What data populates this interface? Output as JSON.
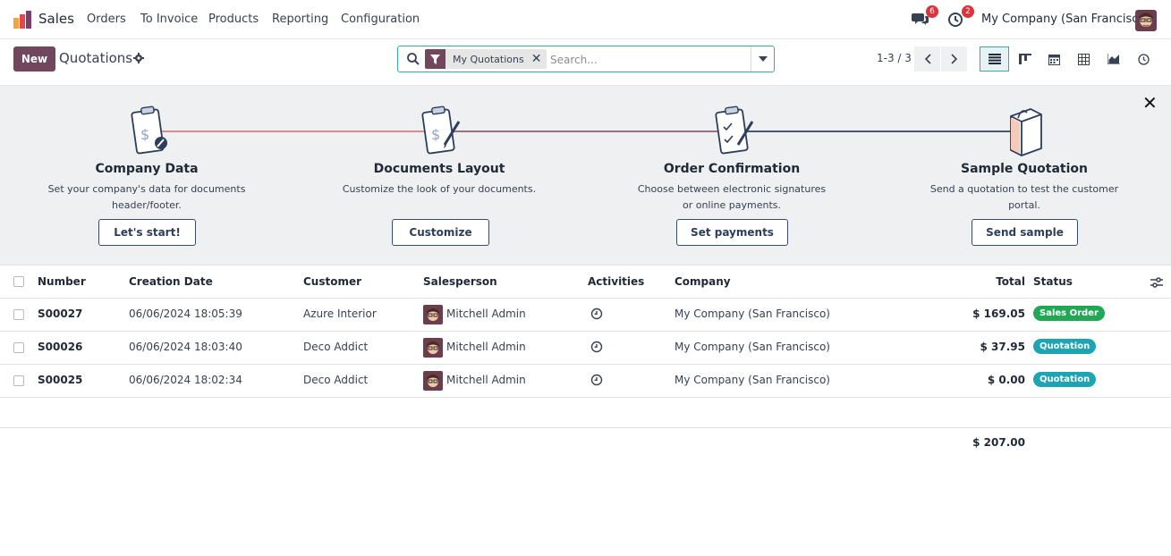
{
  "topbar": {
    "app_name": "Sales",
    "menu": [
      "Orders",
      "To Invoice",
      "Products",
      "Reporting",
      "Configuration"
    ],
    "messages_count": "6",
    "activities_count": "2",
    "company": "My Company (San Francisco)"
  },
  "control": {
    "new_label": "New",
    "breadcrumb": "Quotations",
    "facet": "My Quotations",
    "search_placeholder": "Search...",
    "pager": "1-3 / 3",
    "views": [
      "list-view-icon",
      "kanban-view-icon",
      "calendar-view-icon",
      "pivot-view-icon",
      "graph-view-icon",
      "activity-view-icon"
    ]
  },
  "onboarding": {
    "close": "✕",
    "steps": [
      {
        "title": "Company Data",
        "desc1": "Set your company's data for documents",
        "desc2": "header/footer.",
        "button": "Let's start!"
      },
      {
        "title": "Documents Layout",
        "desc1": "Customize the look of your documents.",
        "desc2": "",
        "button": "Customize"
      },
      {
        "title": "Order Confirmation",
        "desc1": "Choose between electronic signatures",
        "desc2": "or online payments.",
        "button": "Set payments"
      },
      {
        "title": "Sample Quotation",
        "desc1": "Send a quotation to test the customer",
        "desc2": "portal.",
        "button": "Send sample"
      }
    ]
  },
  "table": {
    "headers": {
      "number": "Number",
      "creation_date": "Creation Date",
      "customer": "Customer",
      "salesperson": "Salesperson",
      "activities": "Activities",
      "company": "Company",
      "total": "Total",
      "status": "Status"
    },
    "rows": [
      {
        "number": "S00027",
        "date": "06/06/2024 18:05:39",
        "customer": "Azure Interior",
        "salesperson": "Mitchell Admin",
        "company": "My Company (San Francisco)",
        "total": "$ 169.05",
        "status": "Sales Order"
      },
      {
        "number": "S00026",
        "date": "06/06/2024 18:03:40",
        "customer": "Deco Addict",
        "salesperson": "Mitchell Admin",
        "company": "My Company (San Francisco)",
        "total": "$ 37.95",
        "status": "Quotation"
      },
      {
        "number": "S00025",
        "date": "06/06/2024 18:02:34",
        "customer": "Deco Addict",
        "salesperson": "Mitchell Admin",
        "company": "My Company (San Francisco)",
        "total": "$ 0.00",
        "status": "Quotation"
      }
    ],
    "grand_total": "$ 207.00"
  },
  "colors": {
    "brand": "#71475e",
    "sales_order": "#22a755",
    "quotation": "#1ea5b4",
    "accent": "#3aa6a8"
  }
}
